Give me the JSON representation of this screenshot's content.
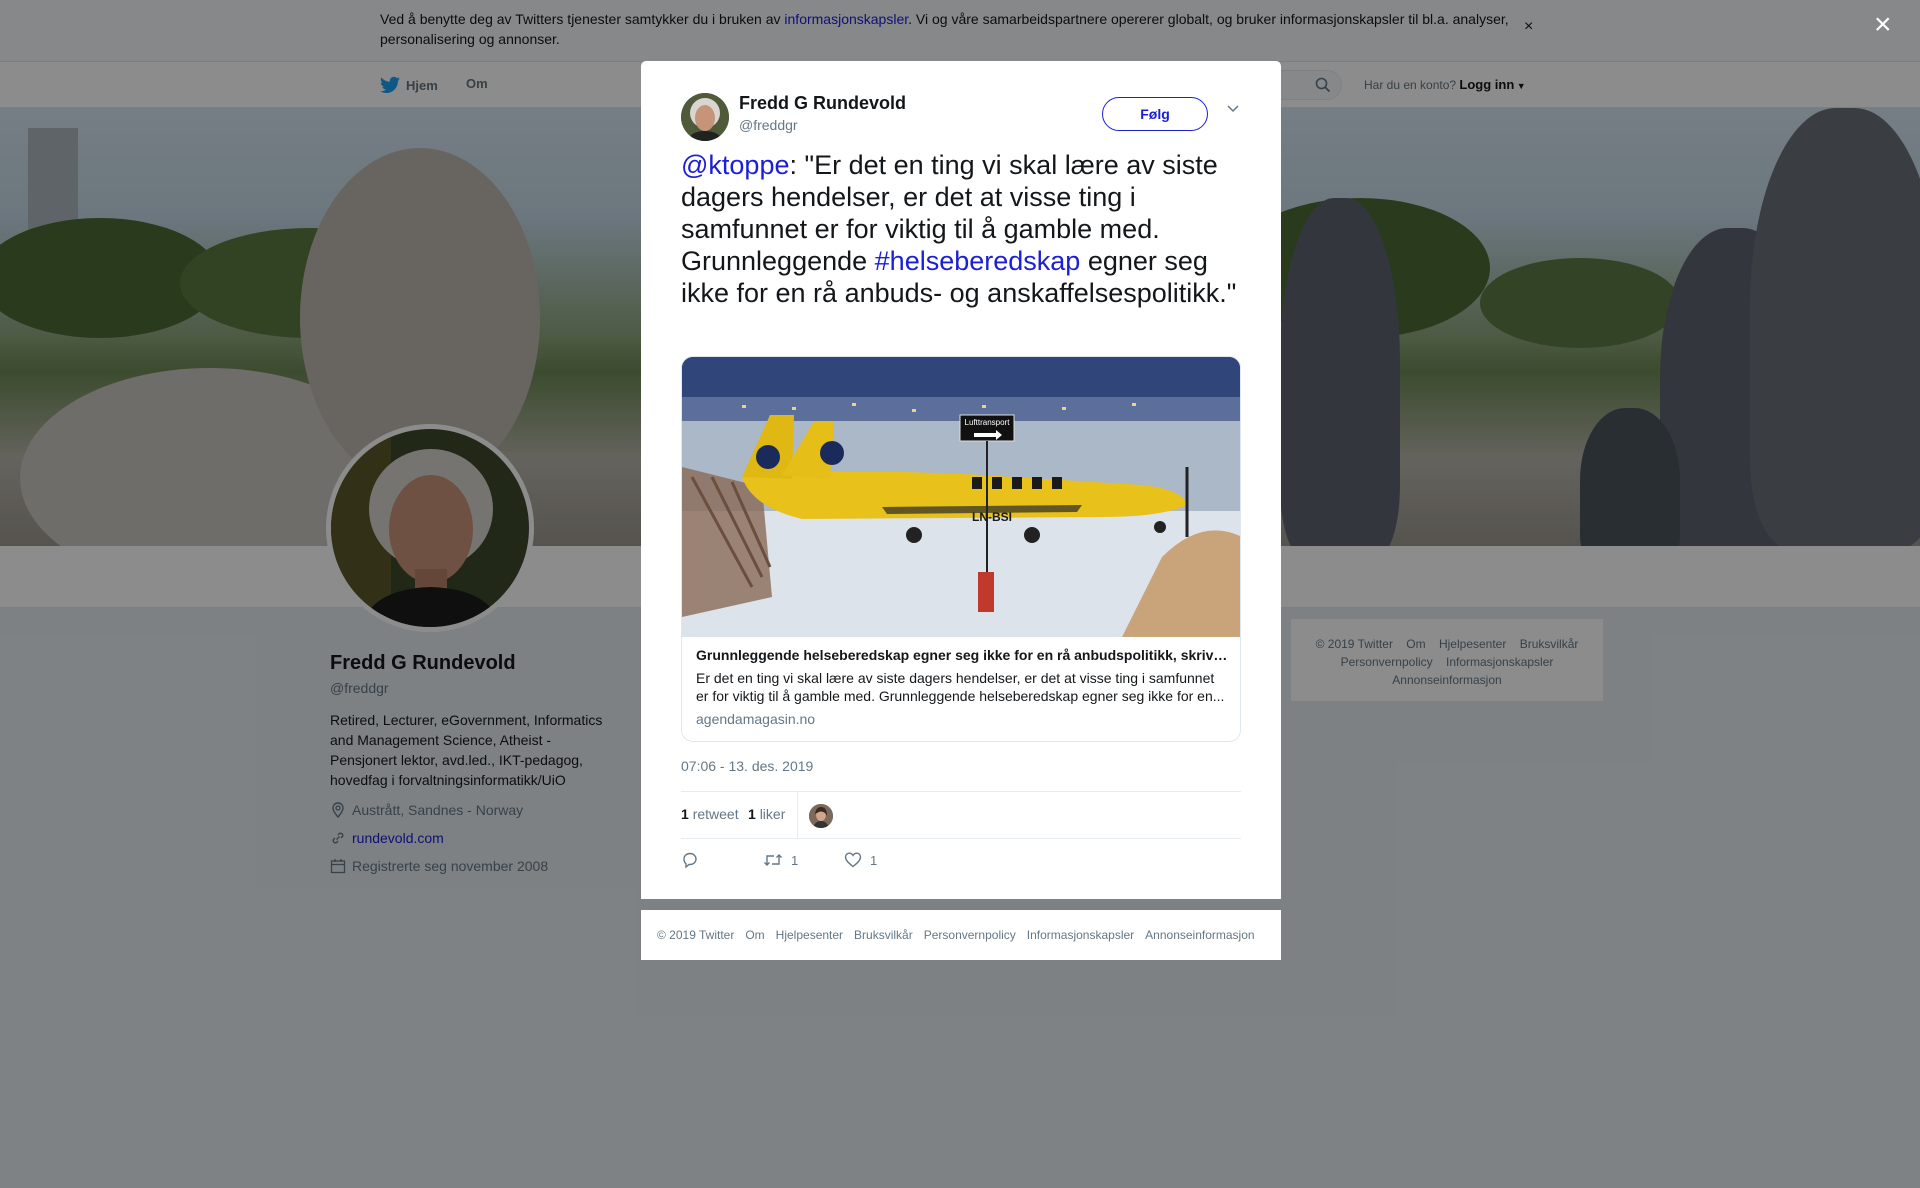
{
  "cookie": {
    "text_before": "Ved å benytte deg av Twitters tjenester samtykker du i bruken av ",
    "link": "informasjonskapsler",
    "text_after": ". Vi og våre samarbeidspartnere opererer globalt, og bruker informasjonskapsler til bl.a. analyser, personalisering og annonser.",
    "close": "×"
  },
  "nav": {
    "home": "Hjem",
    "about": "Om",
    "account_prompt": "Har du en konto?",
    "login": "Logg inn"
  },
  "profile": {
    "name": "Fredd G Rundevold",
    "handle": "@freddgr",
    "bio": "Retired, Lecturer, eGovernment, Informatics and Management Science, Atheist - Pensjonert lektor, avd.led., IKT-pedagog, hovedfag i forvaltningsinformatikk/UiO",
    "location": "Austrått, Sandnes - Norway",
    "website": "rundevold.com",
    "joined": "Registrerte seg november 2008"
  },
  "side_footer": {
    "line1": [
      "© 2019 Twitter",
      "Om",
      "Hjelpesenter",
      "Bruksvilkår"
    ],
    "line2": [
      "Personvernpolicy",
      "Informasjonskapsler"
    ],
    "line3": [
      "Annonseinformasjon"
    ]
  },
  "overlay": {
    "close": "×"
  },
  "tweet": {
    "name": "Fredd G Rundevold",
    "handle": "@freddgr",
    "follow": "Følg",
    "mention": "@ktoppe",
    "text_1": ": \"Er det en ting vi skal lære av siste dagers hendelser, er det at visse ting i samfunnet er for viktig til å gamble med. Grunnleggende ",
    "hashtag": "#helseberedskap",
    "text_2": " egner seg ikke for en rå anbuds- og anskaffelsespolitikk.\"",
    "card": {
      "sign": "Lufttransport",
      "registration": "LN-BSI",
      "title": "Grunnleggende helseberedskap egner seg ikke for en rå anbudspolitikk, skriver Kristin Toppe",
      "description": "Er det en ting vi skal lære av siste dagers hendelser, er det at visse ting i samfunnet er for viktig til å gamble med. Grunnleggende helseberedskap egner seg ikke for en...",
      "domain": "agendamagasin.no"
    },
    "timestamp": "07:06 - 13. des. 2019",
    "retweets_count": "1",
    "retweets_label": "retweet",
    "likes_count": "1",
    "likes_label": "liker",
    "action_retweet_count": "1",
    "action_like_count": "1"
  },
  "modal_footer": [
    "© 2019 Twitter",
    "Om",
    "Hjelpesenter",
    "Bruksvilkår",
    "Personvernpolicy",
    "Informasjonskapsler",
    "Annonseinformasjon"
  ],
  "colors": {
    "link": "#1b20d6",
    "muted": "#657786",
    "text": "#14171a",
    "page_bg": "#e6ecf0"
  }
}
